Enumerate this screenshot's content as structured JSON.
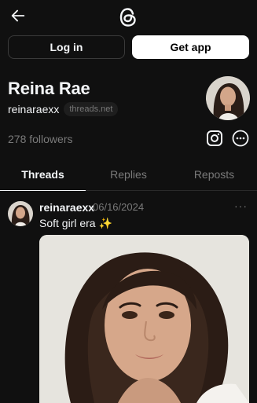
{
  "buttons": {
    "login": "Log in",
    "get_app": "Get app"
  },
  "profile": {
    "name": "Reina Rae",
    "handle": "reinaraexx",
    "domain": "threads.net",
    "followers": "278 followers"
  },
  "tabs": [
    {
      "label": "Threads",
      "active": true
    },
    {
      "label": "Replies",
      "active": false
    },
    {
      "label": "Reposts",
      "active": false
    }
  ],
  "post": {
    "username": "reinaraexx",
    "date": "06/16/2024",
    "text": "Soft girl era ✨",
    "more": "···"
  },
  "icons": {
    "back": "arrow-left-icon",
    "logo": "threads-logo",
    "instagram": "instagram-icon",
    "more": "more-options-icon"
  }
}
